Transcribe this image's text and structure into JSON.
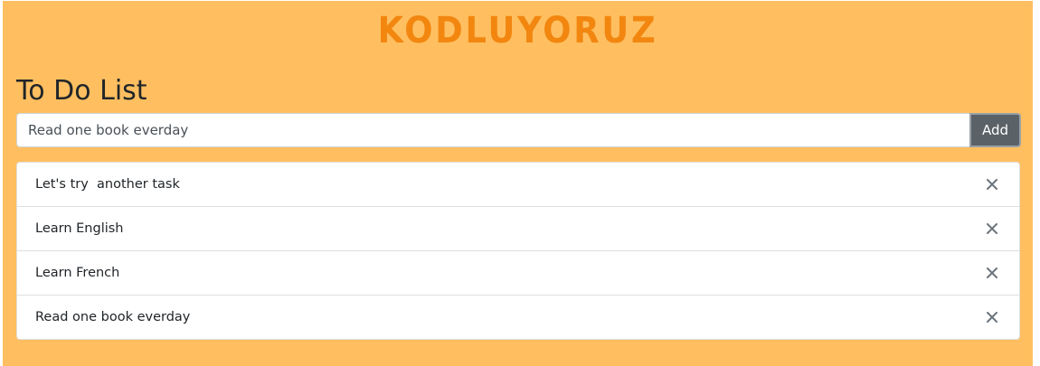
{
  "header": {
    "logo_text": "KODLUYORUZ"
  },
  "main": {
    "title": "To Do List",
    "task_input": {
      "value": "Read one book everday"
    },
    "add_button_label": "Add",
    "tasks": [
      {
        "text": "Let's try  another task"
      },
      {
        "text": "Learn English"
      },
      {
        "text": "Learn French"
      },
      {
        "text": "Read one book everday"
      }
    ]
  },
  "colors": {
    "background": "#ffbf60",
    "logo": "#f2860f",
    "add_button": "#5a6268",
    "close_icon": "#6c757d"
  }
}
